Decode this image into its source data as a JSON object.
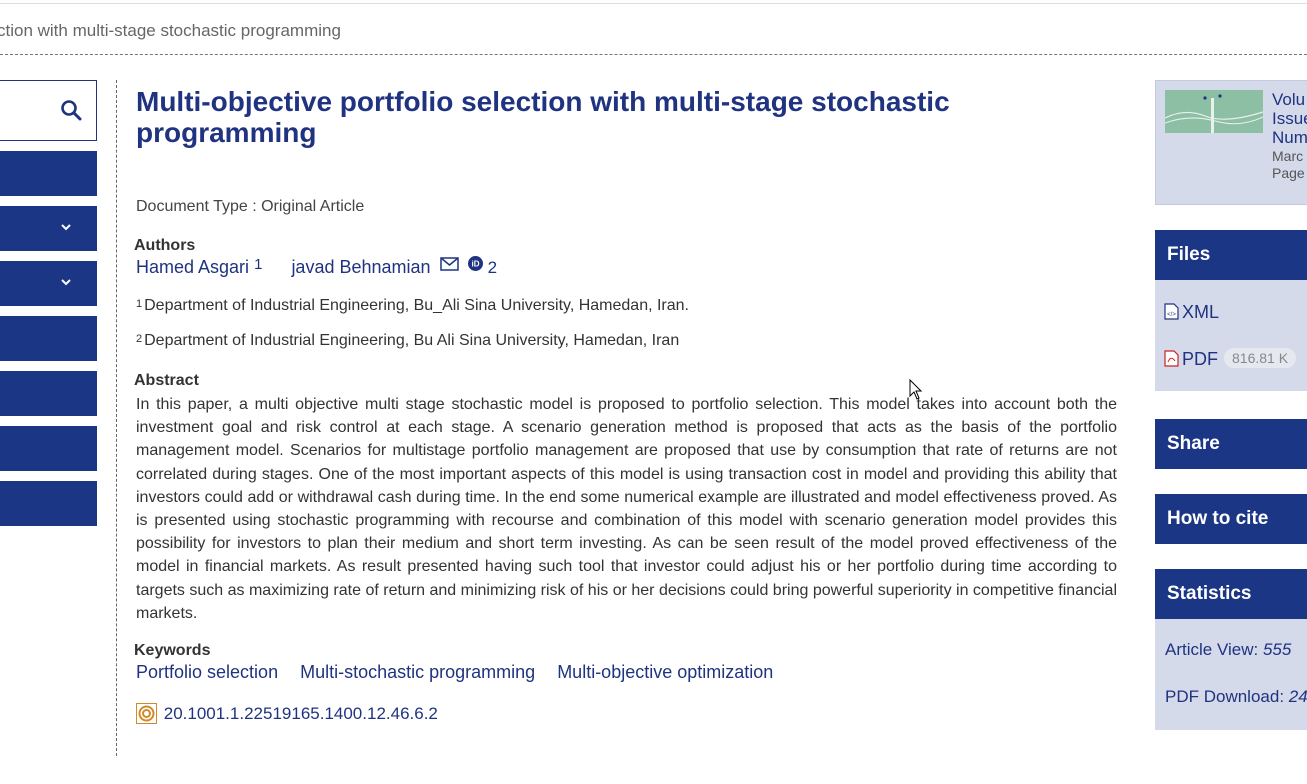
{
  "breadcrumb": {
    "text": "ction with multi-stage stochastic programming"
  },
  "sidebar": {
    "search_icon": "search-icon",
    "buttons": [
      "",
      "dropdown",
      "dropdown",
      "",
      "",
      "",
      ""
    ]
  },
  "article": {
    "title": "Multi-objective portfolio selection with multi-stage stochastic programming",
    "document_type": "Document Type : Original Article",
    "authors_heading": "Authors",
    "authors": [
      {
        "name": "Hamed Asgari",
        "affil": "1"
      },
      {
        "name": "javad Behnamian",
        "affil": "2"
      }
    ],
    "affiliations": [
      {
        "num": "1",
        "text": "Department of Industrial Engineering, Bu_Ali Sina University, Hamedan, Iran."
      },
      {
        "num": "2",
        "text": "Department of Industrial Engineering, Bu Ali Sina University, Hamedan, Iran"
      }
    ],
    "abstract_heading": "Abstract",
    "abstract": "In this paper, a multi objective multi stage stochastic model is proposed to portfolio selection. This model takes into account both the investment goal and risk control at each stage. A scenario generation method is proposed that acts as the basis of the portfolio management model. Scenarios for multistage portfolio management are proposed that use by consumption that rate of returns are not correlated during stages. One of the most important aspects of this model is using transaction cost in model and providing this ability that investors could add or withdrawal cash during time. In the end some numerical example are illustrated and model effectiveness proved. As is presented using stochastic programming with recourse and combination of this model with scenario generation model provides this possibility for investors to plan their medium and short term investing. As can be seen result of the model proved effectiveness of the model in financial markets. As result presented having such tool that investor could adjust his or her portfolio during time according to targets such as maximizing rate of return and minimizing risk of his or her decisions could bring powerful superiority in competitive financial markets.",
    "keywords_heading": "Keywords",
    "keywords": [
      "Portfolio selection",
      "Multi-stochastic programming",
      "Multi-objective optimization"
    ],
    "doi": "20.1001.1.22519165.1400.12.46.6.2"
  },
  "issue": {
    "line1": "Volu",
    "line2": "Issue",
    "line3": "Num",
    "date": "Marc",
    "pages": "Page"
  },
  "files": {
    "heading": "Files",
    "xml_label": "XML",
    "pdf_label": "PDF",
    "pdf_size": "816.81 K"
  },
  "share": {
    "heading": "Share"
  },
  "cite": {
    "heading": "How to cite"
  },
  "statistics": {
    "heading": "Statistics",
    "article_view_label": "Article View: ",
    "article_view_value": "555",
    "pdf_download_label": "PDF Download: ",
    "pdf_download_value": "24"
  },
  "colors": {
    "primary": "#1b3685",
    "link": "#1f3380",
    "panel_bg": "#d5daea"
  }
}
